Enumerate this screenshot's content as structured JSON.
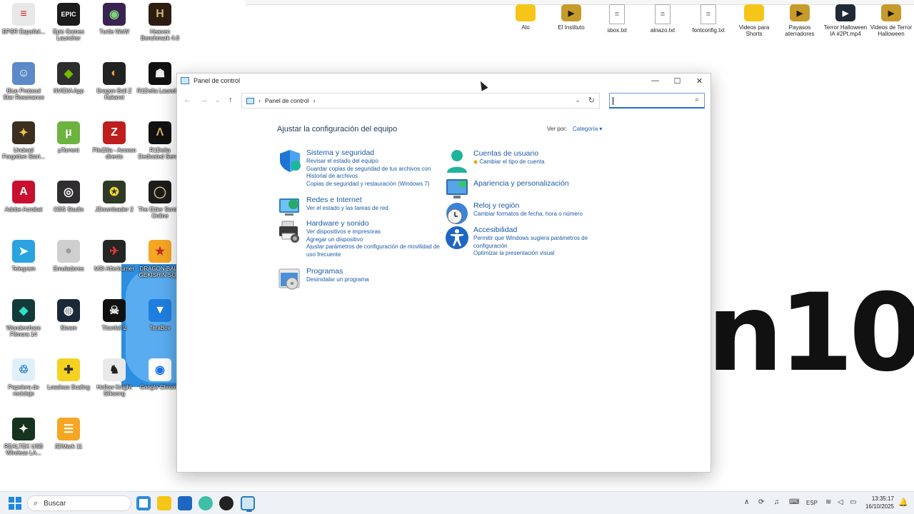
{
  "desktop": {
    "wallpaper_text": "n10",
    "icons": [
      {
        "label": "BPSR Español...",
        "glyph": "≡",
        "color": "#e8e8e8",
        "fg": "#d32f2f"
      },
      {
        "label": "Epic Games\nLauncher",
        "glyph": "EPIC",
        "color": "#1b1b1b",
        "fg": "#ffffff"
      },
      {
        "label": "Turtle WoW",
        "glyph": "◉",
        "color": "#3a2350",
        "fg": "#7bd37b"
      },
      {
        "label": "Heaven\nBenchmark 4.0",
        "glyph": "H",
        "color": "#2b1d12",
        "fg": "#d8b06a"
      },
      {
        "label": "Blue Protocol\nStar Resonance",
        "glyph": "☺",
        "color": "#5c8ac9",
        "fg": "#ffffff"
      },
      {
        "label": "NVIDIA App",
        "glyph": "◆",
        "color": "#2e2e2e",
        "fg": "#76b900"
      },
      {
        "label": "Dragon Ball Z\nKakarot",
        "glyph": "◐",
        "color": "#222",
        "fg": "#f2a33a"
      },
      {
        "label": "R1Delta Launcher",
        "glyph": "☗",
        "color": "#111",
        "fg": "#eee"
      },
      {
        "label": "Undead\nForgotten Stori...",
        "glyph": "✦",
        "color": "#3c2f1e",
        "fg": "#f0c34a"
      },
      {
        "label": "µTorrent",
        "glyph": "µ",
        "color": "#6cb33f",
        "fg": "#ffffff"
      },
      {
        "label": "FileZilla - Acceso\ndirecto",
        "glyph": "Z",
        "color": "#bf1e1e",
        "fg": "#ffffff"
      },
      {
        "label": "R1Delta\nDedicated Serv...",
        "glyph": "Λ",
        "color": "#111",
        "fg": "#d5a45a"
      },
      {
        "label": "Adobe Acrobat",
        "glyph": "A",
        "color": "#c8102e",
        "fg": "#ffffff"
      },
      {
        "label": "OBS Studio",
        "glyph": "◎",
        "color": "#302e31",
        "fg": "#ffffff"
      },
      {
        "label": "JDownloader 2",
        "glyph": "✪",
        "color": "#2f3a26",
        "fg": "#f2d32f"
      },
      {
        "label": "The Elder Scrolls\nOnline",
        "glyph": "◯",
        "color": "#1c1c1c",
        "fg": "#c9b27a"
      },
      {
        "label": "Telegram",
        "glyph": "➤",
        "color": "#2aa3e0",
        "fg": "#ffffff"
      },
      {
        "label": "Emuladores",
        "glyph": "●",
        "color": "#cfcfcf",
        "fg": "#9a9a9a"
      },
      {
        "label": "MSI Afterburner",
        "glyph": "✈",
        "color": "#252525",
        "fg": "#e53935"
      },
      {
        "label": "DRAGON BALL\nGEKISHIN SQ...",
        "glyph": "★",
        "color": "#f5a623",
        "fg": "#c62828"
      },
      {
        "label": "Wondershare\nFilmora 14",
        "glyph": "◆",
        "color": "#133a3a",
        "fg": "#2de0c4"
      },
      {
        "label": "Steam",
        "glyph": "◍",
        "color": "#1b2838",
        "fg": "#ffffff"
      },
      {
        "label": "Titanfall 2",
        "glyph": "☠",
        "color": "#111",
        "fg": "#eee"
      },
      {
        "label": "TeraBox",
        "glyph": "▼",
        "color": "#1f7fe0",
        "fg": "#ffffff"
      },
      {
        "label": "Papelera de\nreciclaje",
        "glyph": "♲",
        "color": "#dff0fa",
        "fg": "#2f7fc1"
      },
      {
        "label": "Lossless Scaling",
        "glyph": "✚",
        "color": "#f4d21f",
        "fg": "#333"
      },
      {
        "label": "Hollow Knight\nSilksong",
        "glyph": "♞",
        "color": "#e9e9e9",
        "fg": "#222"
      },
      {
        "label": "Google Chrome",
        "glyph": "◉",
        "color": "#ffffff",
        "fg": "#1a73e8"
      },
      {
        "label": "REALTEK USB\nWireless LA...",
        "glyph": "✦",
        "color": "#15331e",
        "fg": "#ffffff"
      },
      {
        "label": "3DMark 11",
        "glyph": "☰",
        "color": "#f5a623",
        "fg": "#ffffff"
      }
    ],
    "top_icons": [
      {
        "label": "Alo",
        "glyph": "▬",
        "color": "#f5c518",
        "fg": "#f5c518"
      },
      {
        "label": "El Instituto",
        "glyph": "▶",
        "color": "#c79b2a",
        "fg": "#1c1c1c"
      },
      {
        "label": "sbox.txt",
        "glyph": "≡",
        "color": "#ffffff",
        "fg": "#777"
      },
      {
        "label": "alnazo.txt",
        "glyph": "≡",
        "color": "#ffffff",
        "fg": "#777"
      },
      {
        "label": "fontconfig.txt",
        "glyph": "≡",
        "color": "#ffffff",
        "fg": "#777"
      },
      {
        "label": "Videos para\nShorts",
        "glyph": "▬",
        "color": "#f5c518",
        "fg": "#f5c518"
      },
      {
        "label": "Payasos\naterradores",
        "glyph": "▶",
        "color": "#c79b2a",
        "fg": "#1c1c1c"
      },
      {
        "label": "Terror Halloween\nIA #2Pt.mp4",
        "glyph": "▶",
        "color": "#1f2a35",
        "fg": "#ffffff"
      },
      {
        "label": "Videos de Terror\nHalloween",
        "glyph": "▶",
        "color": "#c79b2a",
        "fg": "#1c1c1c"
      }
    ]
  },
  "window": {
    "title": "Panel de control",
    "minimize": "—",
    "maximize": "☐",
    "close": "✕",
    "nav": {
      "back": "←",
      "forward": "→",
      "recent": "⌄",
      "up": "↑"
    },
    "address": {
      "separator": "›",
      "crumb": "Panel de control",
      "trail": "›",
      "dropdown": "⌄",
      "refresh": "↻"
    },
    "search": {
      "value": "",
      "placeholder": "",
      "icon": "⌕"
    },
    "heading": "Ajustar la configuración del equipo",
    "view_by_label": "Ver por:",
    "view_by_value": "Categoría ▾",
    "categories_left": [
      {
        "title": "Sistema y seguridad",
        "links": [
          "Revisar el estado del equipo",
          "Guardar copias de seguridad de tus archivos con",
          "Historial de archivos",
          "Copias de seguridad y restauración (Windows 7)"
        ]
      },
      {
        "title": "Redes e Internet",
        "links": [
          "Ver el estado y las tareas de red"
        ]
      },
      {
        "title": "Hardware y sonido",
        "links": [
          "Ver dispositivos e impresoras",
          "Agregar un dispositivo",
          "Ajustar parámetros de configuración de movilidad de",
          "uso frecuente"
        ]
      },
      {
        "title": "Programas",
        "links": [
          "Desinstalar un programa"
        ]
      }
    ],
    "categories_right": [
      {
        "title": "Cuentas de usuario",
        "links": [
          "Cambiar el tipo de cuenta"
        ]
      },
      {
        "title": "Apariencia y personalización",
        "links": []
      },
      {
        "title": "Reloj y región",
        "links": [
          "Cambiar formatos de fecha, hora o número"
        ]
      },
      {
        "title": "Accesibilidad",
        "links": [
          "Permitir que Windows sugiera parámetros de",
          "configuración",
          "Optimizar la presentación visual"
        ]
      }
    ]
  },
  "taskbar": {
    "search_label": "Buscar",
    "search_icon": "⌕",
    "tray": {
      "chevron": "∧",
      "language": "ESP"
    },
    "time": "13:35:17",
    "date": "16/10/2025",
    "bell": "🔔"
  }
}
